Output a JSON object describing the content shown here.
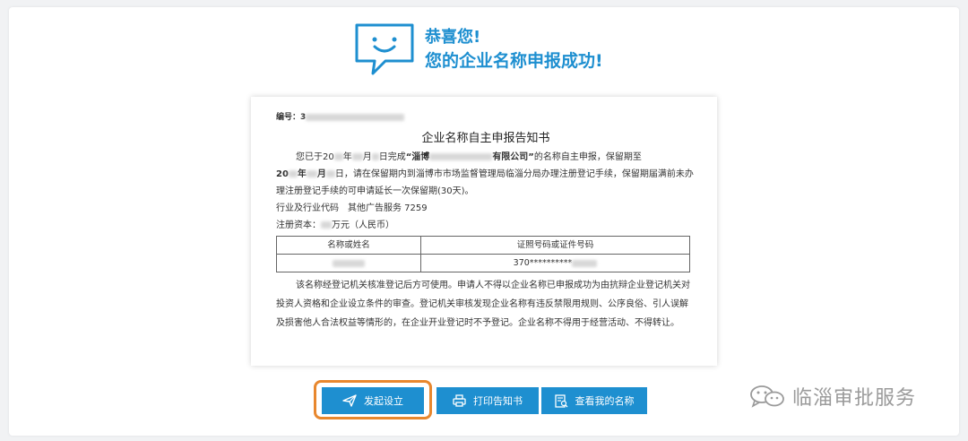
{
  "success": {
    "title": "恭喜您!",
    "subtitle": "您的企业名称申报成功!"
  },
  "notice": {
    "serial_label": "编号：3",
    "title": "企业名称自主申报告知书",
    "p1_a": "您已于20",
    "p1_b": "年",
    "p1_c": "月",
    "p1_d": "日完成",
    "p1_e": "“淄博",
    "p1_f": "有限公司”",
    "p1_g": "的名称自主申报，保留期至",
    "p1_h": "20",
    "p1_i": "年",
    "p1_j": "月",
    "p1_k": "日，请在保留期内到淄博市市场监督管理局临淄分局办理注册登记手续，保留期届满前未办理注册登记手续的可申请延长一次保留期(30天)。",
    "industry": "行业及行业代码　其他广告服务 7259",
    "capital_a": "注册资本：",
    "capital_b": "万元（人民币）",
    "table_headers": [
      "名称或姓名",
      "证照号码或证件号码"
    ],
    "table_id_prefix": "370**********",
    "p2": "该名称经登记机关核准登记后方可使用。申请人不得以企业名称已申报成功为由抗辩企业登记机关对投资人资格和企业设立条件的审查。登记机关审核发现企业名称有违反禁限用规则、公序良俗、引人误解及损害他人合法权益等情形的，在企业开业登记时不予登记。企业名称不得用于经营活动、不得转让。"
  },
  "buttons": {
    "start": "发起设立",
    "print": "打印告知书",
    "view": "查看我的名称"
  },
  "watermark": {
    "text": "临淄审批服务",
    "icon": "wechat-icon"
  },
  "colors": {
    "accent": "#1e8fd0",
    "highlight": "#e8872e"
  }
}
